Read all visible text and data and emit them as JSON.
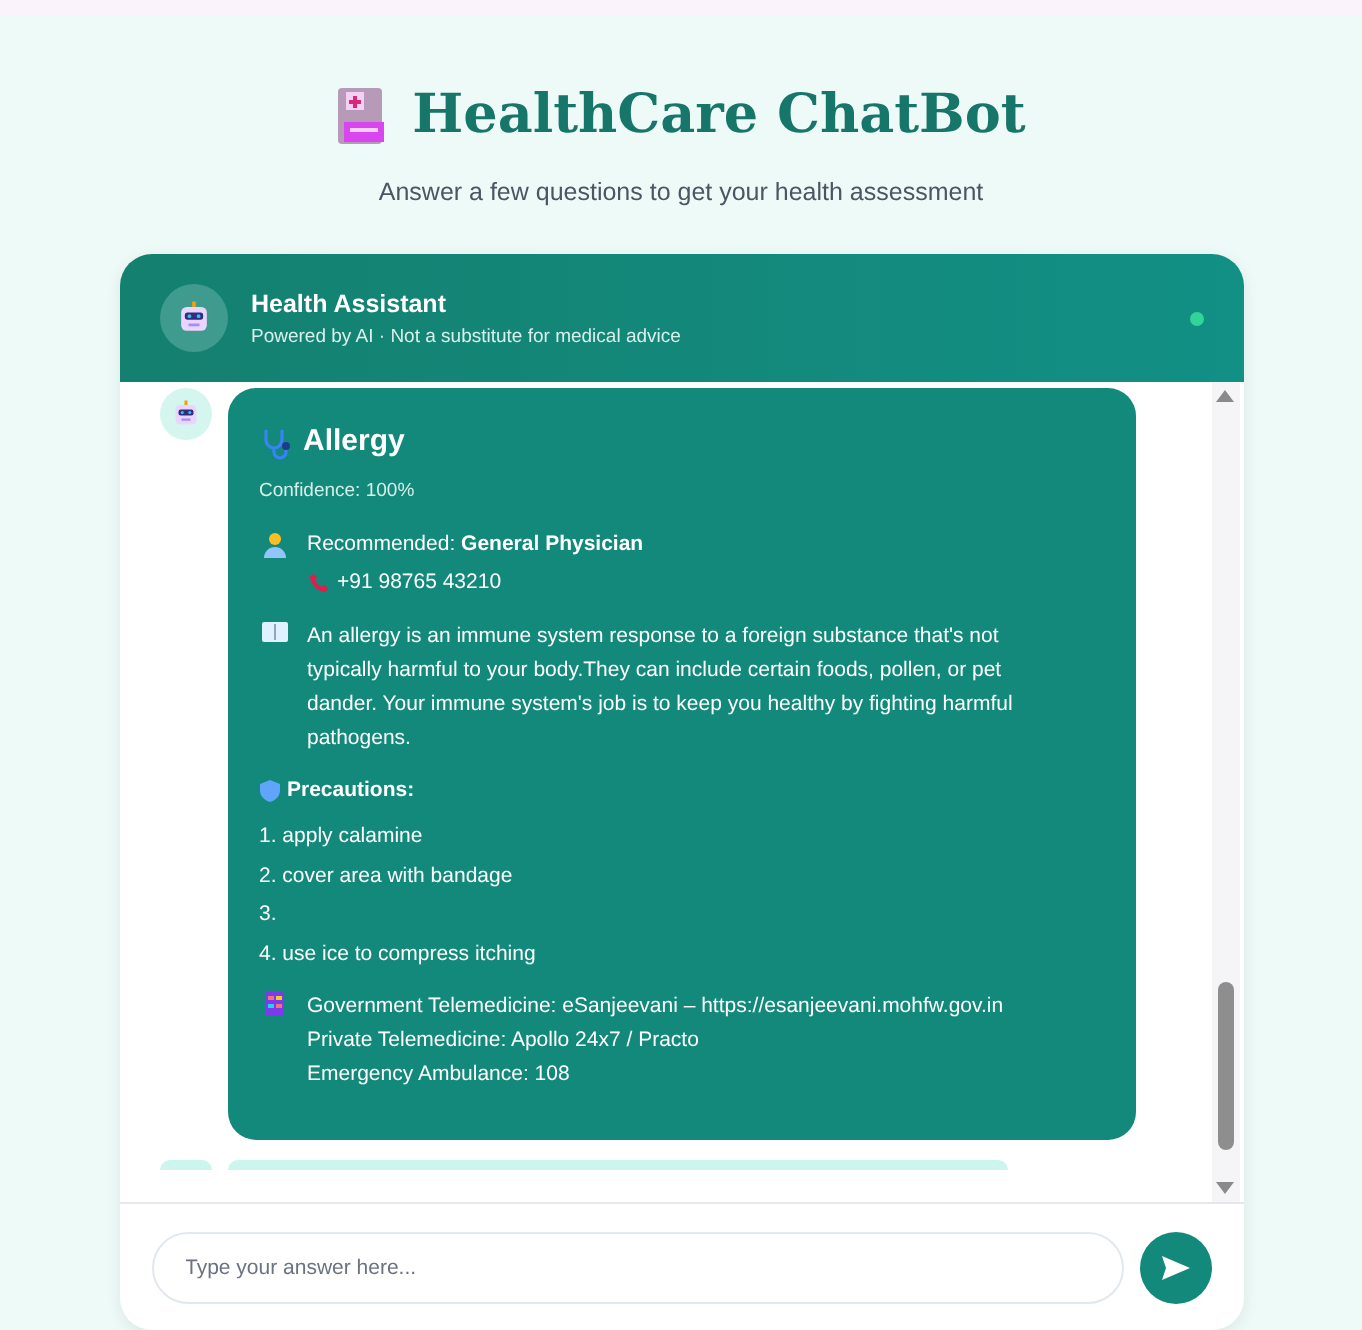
{
  "page": {
    "title": "HealthCare ChatBot",
    "subtitle": "Answer a few questions to get your health assessment"
  },
  "chat_header": {
    "name": "Health Assistant",
    "tagline": "Powered by AI · Not a substitute for medical advice",
    "online": true
  },
  "message": {
    "condition": "Allergy",
    "confidence": "Confidence: 100%",
    "recommended": "Recommended: **General Physician**",
    "phone": "+91 98765 43210",
    "description": "An allergy is an immune system response to a foreign substance that's not typically harmful to your body.They can include certain foods, pollen, or pet dander. Your immune system's job is to keep you healthy by fighting harmful pathogens.",
    "precautions_heading": "Precautions:",
    "precautions": [
      {
        "number": "1.",
        "text": "apply calamine"
      },
      {
        "number": "2.",
        "text": "cover area with bandage"
      },
      {
        "number": "3."
      },
      {
        "number": "4.",
        "text": "use ice to compress itching"
      }
    ],
    "resources": [
      "Government Telemedicine: eSanjeevani – https://esanjeevani.mohfw.gov.in",
      "Private Telemedicine: Apollo 24x7 / Practo",
      "Emergency Ambulance: 108"
    ]
  },
  "input": {
    "placeholder": "Type your answer here..."
  }
}
